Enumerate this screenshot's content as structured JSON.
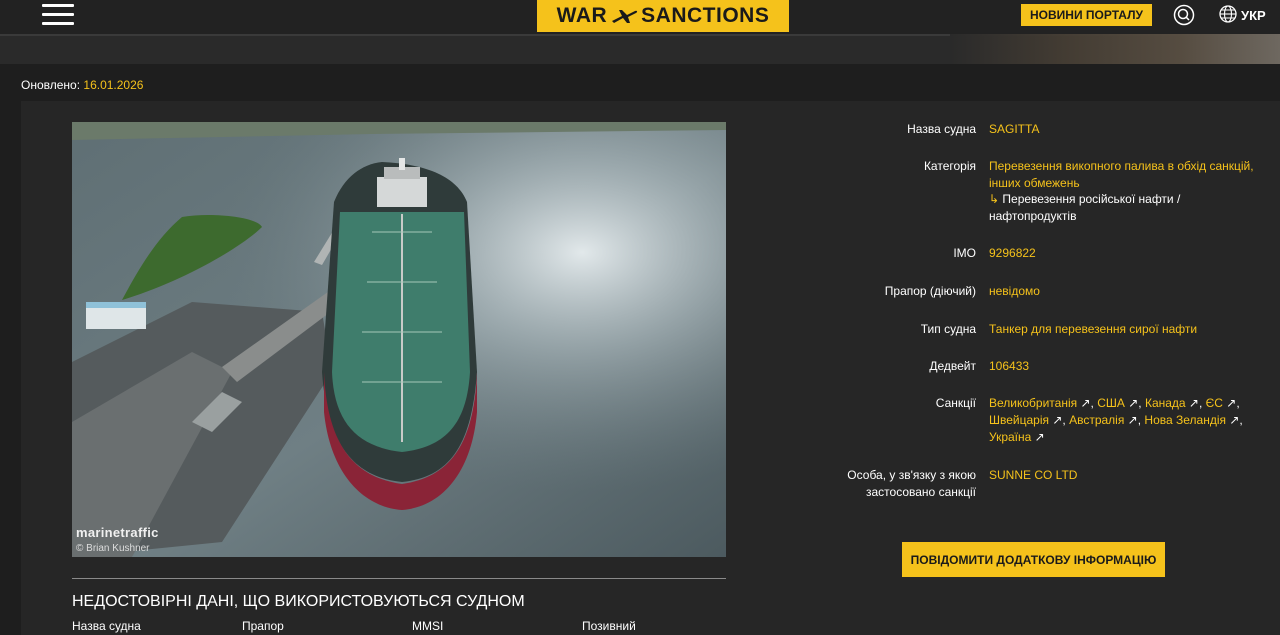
{
  "header": {
    "logo_left": "WAR",
    "logo_right": "SANCTIONS",
    "news_button": "НОВИНИ ПОРТАЛУ",
    "language": "УКР",
    "accent": "#f5c21b"
  },
  "updated": {
    "label": "Оновлено:",
    "date": "16.01.2026"
  },
  "photo": {
    "watermark": "marinetraffic",
    "credit": "© Brian Kushner"
  },
  "info": {
    "name_label": "Назва судна",
    "name_value": "SAGITTA",
    "category_label": "Категорія",
    "category_line1": "Перевезення викопного палива в обхід санкцій,",
    "category_line2": "інших обмежень",
    "subcategory_line1": "Перевезення російської нафти /",
    "subcategory_line2": "нафтопродуктів",
    "imo_label": "IMO",
    "imo_value": "9296822",
    "flag_label": "Прапор (діючий)",
    "flag_value": "невідомо",
    "type_label": "Тип судна",
    "type_value": "Танкер для перевезення сирої нафти",
    "deadweight_label": "Дедвейт",
    "deadweight_value": "106433",
    "sanctions_label": "Санкції",
    "sanctions": [
      "Великобританія",
      "США",
      "Канада",
      "ЄС",
      "Швейцарія",
      "Австралія",
      "Нова Зеландія",
      "Україна"
    ],
    "person_label_line1": "Особа, у зв'язку з якою",
    "person_label_line2": "застосовано санкції",
    "person_value": "SUNNE CO LTD"
  },
  "report_button": "ПОВІДОМИТИ ДОДАТКОВУ ІНФОРМАЦІЮ",
  "unreliable": {
    "title": "НЕДОСТОВІРНІ ДАНІ, ЩО ВИКОРИСТОВУЮТЬСЯ СУДНОМ",
    "columns": [
      "Назва судна",
      "Прапор",
      "MMSI",
      "Позивний"
    ]
  },
  "icons": [
    "menu-icon",
    "plane-icon",
    "search-icon",
    "globe-icon",
    "external-link-icon"
  ]
}
